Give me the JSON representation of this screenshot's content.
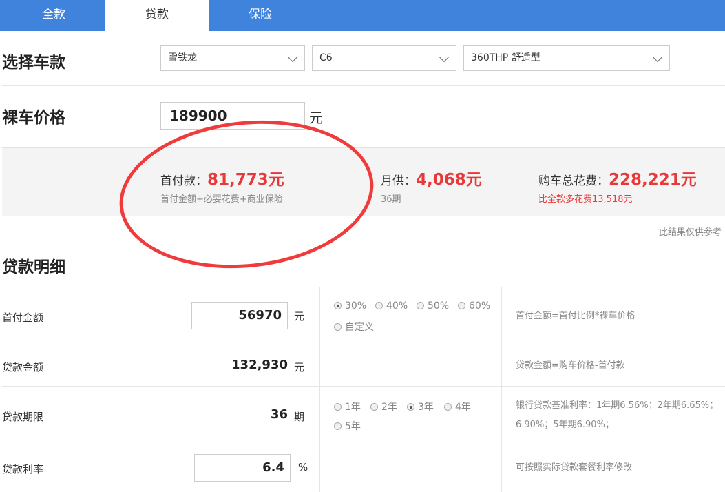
{
  "tabs": [
    {
      "label": "全款",
      "active": false
    },
    {
      "label": "贷款",
      "active": true
    },
    {
      "label": "保险",
      "active": false
    }
  ],
  "select_car": {
    "title": "选择车款",
    "brand": "雪铁龙",
    "series": "C6",
    "model": "360THP 舒适型"
  },
  "price": {
    "title": "裸车价格",
    "value": "189900",
    "unit": "元"
  },
  "summary": {
    "down_label": "首付款：",
    "down_value": "81,773元",
    "down_sub": "首付金额+必要花费+商业保险",
    "monthly_label": "月供：",
    "monthly_value": "4,068元",
    "monthly_sub": "36期",
    "total_label": "购车总花费：",
    "total_value": "228,221元",
    "total_sub": "比全款多花费13,518元",
    "disclaimer": "此结果仅供参考"
  },
  "detail": {
    "title": "贷款明细",
    "rows": {
      "down": {
        "label": "首付金额",
        "value": "56970",
        "unit": "元",
        "options": [
          "30%",
          "40%",
          "50%",
          "60%",
          "自定义"
        ],
        "selected": "30%",
        "note": "首付金额=首付比例*裸车价格"
      },
      "loan": {
        "label": "贷款金额",
        "value": "132,930",
        "unit": "元",
        "note": "贷款金额=购车价格-首付款"
      },
      "term": {
        "label": "贷款期限",
        "value": "36",
        "unit": "期",
        "options": [
          "1年",
          "2年",
          "3年",
          "4年",
          "5年"
        ],
        "selected": "3年",
        "note_line1": "银行贷款基准利率：1年期6.56%；2年期6.65%；",
        "note_line2": "6.90%；5年期6.90%；"
      },
      "rate": {
        "label": "贷款利率",
        "value": "6.4",
        "unit": "%",
        "note": "可按照实际贷款套餐利率修改"
      }
    }
  },
  "colors": {
    "tab_bar": "#3f83dd",
    "accent_red": "#e8393a",
    "annotation_circle": "#ef3b3b"
  }
}
